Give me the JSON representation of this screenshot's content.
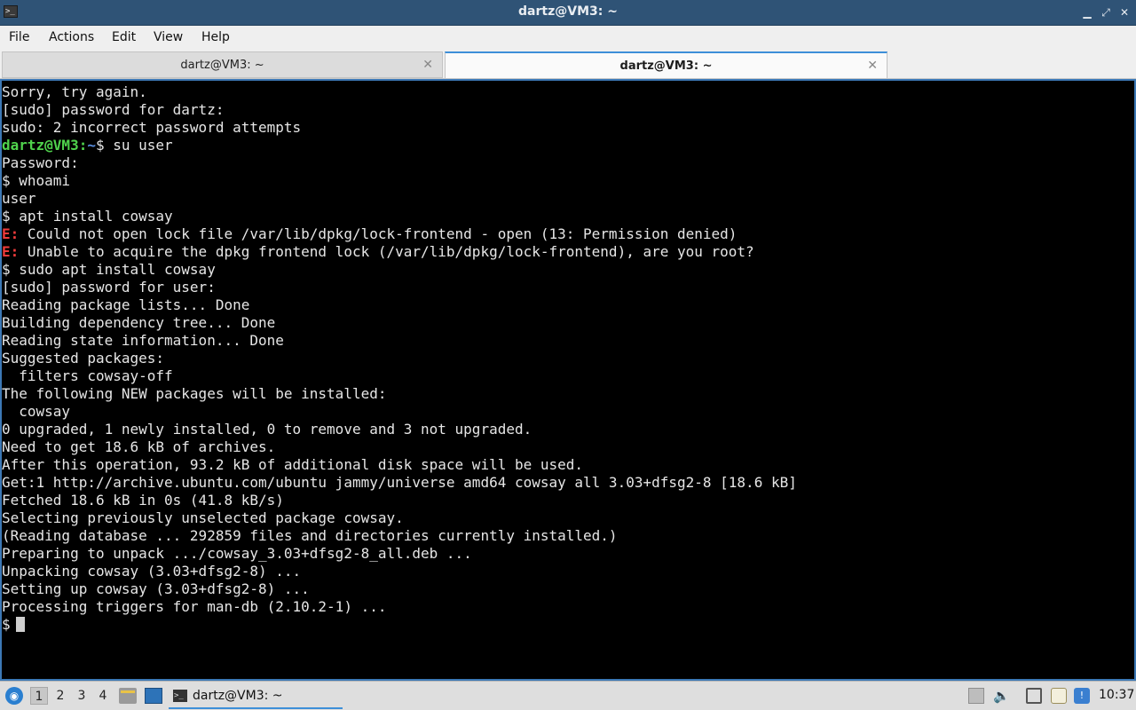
{
  "window": {
    "title": "dartz@VM3: ~",
    "icon": "terminal-icon",
    "controls": [
      "minimize",
      "maximize",
      "close"
    ]
  },
  "menu": [
    "File",
    "Actions",
    "Edit",
    "View",
    "Help"
  ],
  "tabs": [
    {
      "label": "dartz@VM3: ~",
      "active": false
    },
    {
      "label": "dartz@VM3: ~",
      "active": true
    }
  ],
  "terminal": {
    "prompt_user_host": "dartz@VM3:",
    "prompt_path": "~",
    "lines": [
      "Sorry, try again.",
      "[sudo] password for dartz:",
      "sudo: 2 incorrect password attempts",
      "$ su user",
      "Password:",
      "$ whoami",
      "user",
      "$ apt install cowsay",
      "E:",
      " Could not open lock file /var/lib/dpkg/lock-frontend - open (13: Permission denied)",
      "E:",
      " Unable to acquire the dpkg frontend lock (/var/lib/dpkg/lock-frontend), are you root?",
      "$ sudo apt install cowsay",
      "[sudo] password for user:",
      "Reading package lists... Done",
      "Building dependency tree... Done",
      "Reading state information... Done",
      "Suggested packages:",
      "  filters cowsay-off",
      "The following NEW packages will be installed:",
      "  cowsay",
      "0 upgraded, 1 newly installed, 0 to remove and 3 not upgraded.",
      "Need to get 18.6 kB of archives.",
      "After this operation, 93.2 kB of additional disk space will be used.",
      "Get:1 http://archive.ubuntu.com/ubuntu jammy/universe amd64 cowsay all 3.03+dfsg2-8 [18.6 kB]",
      "Fetched 18.6 kB in 0s (41.8 kB/s)",
      "Selecting previously unselected package cowsay.",
      "(Reading database ... 292859 files and directories currently installed.)",
      "Preparing to unpack .../cowsay_3.03+dfsg2-8_all.deb ...",
      "Unpacking cowsay (3.03+dfsg2-8) ...",
      "Setting up cowsay (3.03+dfsg2-8) ...",
      "Processing triggers for man-db (2.10.2-1) ...",
      "$"
    ]
  },
  "taskbar": {
    "workspaces": [
      "1",
      "2",
      "3",
      "4"
    ],
    "active_workspace": "1",
    "task_label": "dartz@VM3: ~",
    "clock": "10:37"
  },
  "colors": {
    "titlebar": "#2f5376",
    "accent": "#3d8fd8",
    "prompt_user": "#4fd24c",
    "prompt_path": "#5b8fe0",
    "error": "#ef3b3b"
  }
}
